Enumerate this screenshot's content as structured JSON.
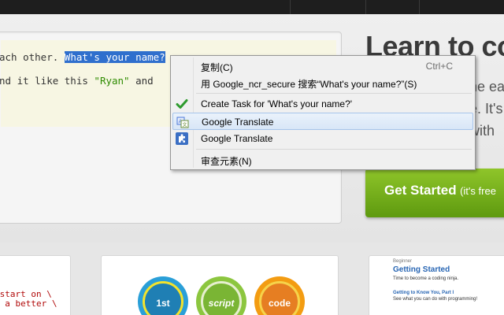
{
  "editor": {
    "line1_before": "ach other. ",
    "line1_selected": "What's your name?",
    "line2_before": "nd it like this ",
    "line2_string": "\"Ryan\"",
    "line2_after": " and "
  },
  "hero": {
    "title": "Learn to co",
    "line1": "he ea",
    "line2": "e. It's",
    "line3": "with",
    "cta_main": "Get Started",
    "cta_sub": "(it's free"
  },
  "cards": {
    "code_line1": "[",
    "code_line2": " start on \\",
    "code_line3": "g a better \\",
    "badge1": "1st",
    "badge2": "script",
    "badge3": "code",
    "lesson_tag": "Beginner",
    "lesson_title": "Getting Started",
    "lesson_desc": "Time to become a coding ninja.",
    "lesson_sub": "Getting to Know You, Part I",
    "lesson_sub_desc": "See what you can do with programming!"
  },
  "context_menu": {
    "items": [
      {
        "label": "复制(C)",
        "shortcut": "Ctrl+C",
        "icon": ""
      },
      {
        "label": "用 Google_ncr_secure 搜索“What's your name?”(S)",
        "shortcut": "",
        "icon": ""
      },
      {
        "label": "Create Task for 'What's your name?'",
        "shortcut": "",
        "icon": "checkmark-icon"
      },
      {
        "label": "Google Translate",
        "shortcut": "",
        "icon": "translate-icon"
      },
      {
        "label": "Google Translate",
        "shortcut": "",
        "icon": "puzzle-extension-icon"
      },
      {
        "label": "审查元素(N)",
        "shortcut": "",
        "icon": ""
      }
    ],
    "highlighted_index": 3
  },
  "colors": {
    "selection": "#2f6fcd",
    "cta_green": "#6fae18",
    "menu_bg": "#f0f0f0",
    "highlight": "#d8e6f7"
  }
}
